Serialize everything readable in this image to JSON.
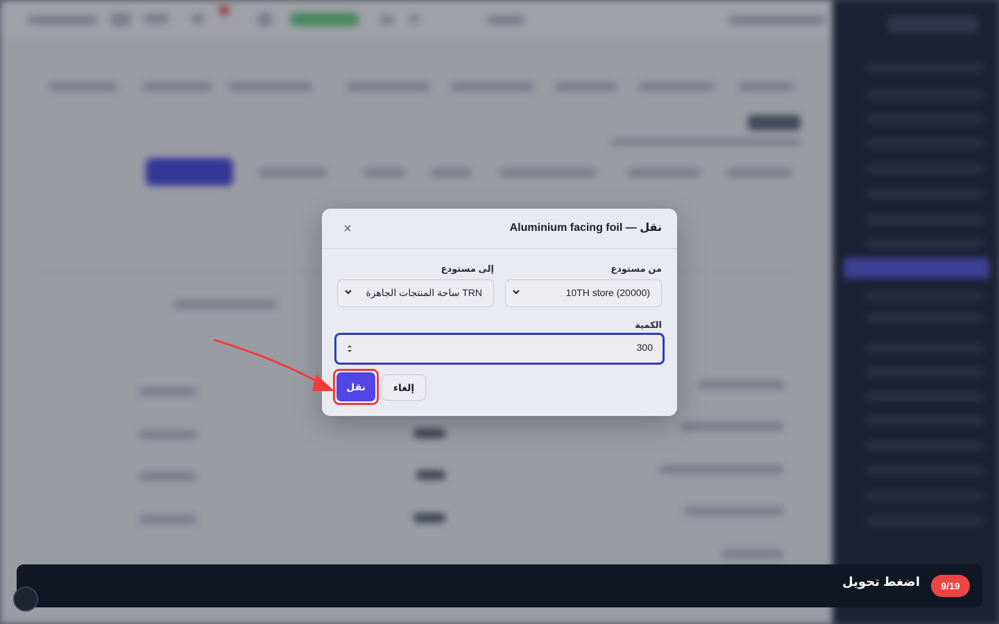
{
  "dialog": {
    "title": "نقل — Aluminium facing foil",
    "close_label": "×",
    "from_warehouse": {
      "label": "من مستودع",
      "value": "10TH store (20000)"
    },
    "to_warehouse": {
      "label": "إلى مستودع",
      "value": "TRN ساحة المنتجات الجاهزة"
    },
    "quantity": {
      "label": "الكمية",
      "value": "300"
    },
    "cancel_label": "إلغاء",
    "submit_label": "نقل"
  },
  "tour": {
    "step": "9/19",
    "instruction": "اضغط تحويل"
  },
  "colors": {
    "primary": "#4f46e5",
    "highlight": "#ef3b3b",
    "step_badge": "#ef4444",
    "tour_bar": "#121726",
    "sidebar": "#141a2e"
  }
}
